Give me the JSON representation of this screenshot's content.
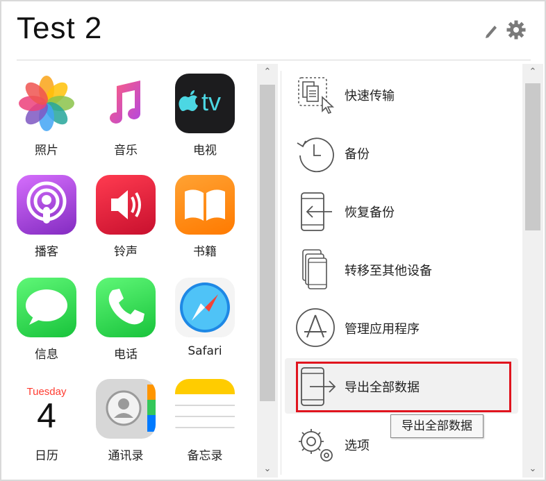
{
  "device": {
    "name": "Test 2"
  },
  "header": {
    "edit_icon": "pencil-icon",
    "settings_icon": "gear-icon"
  },
  "apps": [
    {
      "label": "照片",
      "icon": "photos-icon"
    },
    {
      "label": "音乐",
      "icon": "music-icon"
    },
    {
      "label": "电视",
      "icon": "apple-tv-icon",
      "icon_text": "tv"
    },
    {
      "label": "播客",
      "icon": "podcasts-icon"
    },
    {
      "label": "铃声",
      "icon": "ringtones-icon"
    },
    {
      "label": "书籍",
      "icon": "books-icon"
    },
    {
      "label": "信息",
      "icon": "messages-icon"
    },
    {
      "label": "电话",
      "icon": "phone-icon"
    },
    {
      "label": "Safari",
      "icon": "safari-icon"
    },
    {
      "label": "日历",
      "icon": "calendar-icon",
      "icon_day_name": "Tuesday",
      "icon_day_number": "4"
    },
    {
      "label": "通讯录",
      "icon": "contacts-icon"
    },
    {
      "label": "备忘录",
      "icon": "notes-icon"
    }
  ],
  "actions": [
    {
      "label": "快速传输",
      "icon": "quick-transfer-icon"
    },
    {
      "label": "备份",
      "icon": "backup-icon"
    },
    {
      "label": "恢复备份",
      "icon": "restore-backup-icon"
    },
    {
      "label": "转移至其他设备",
      "icon": "transfer-device-icon"
    },
    {
      "label": "管理应用程序",
      "icon": "app-store-icon"
    },
    {
      "label": "导出全部数据",
      "icon": "export-data-icon",
      "highlighted": true
    },
    {
      "label": "选项",
      "icon": "options-gear-icon"
    }
  ],
  "tooltip": {
    "text": "导出全部数据"
  },
  "colors": {
    "highlight_border": "#e0141e",
    "scroll_thumb": "#c9c9c9"
  }
}
